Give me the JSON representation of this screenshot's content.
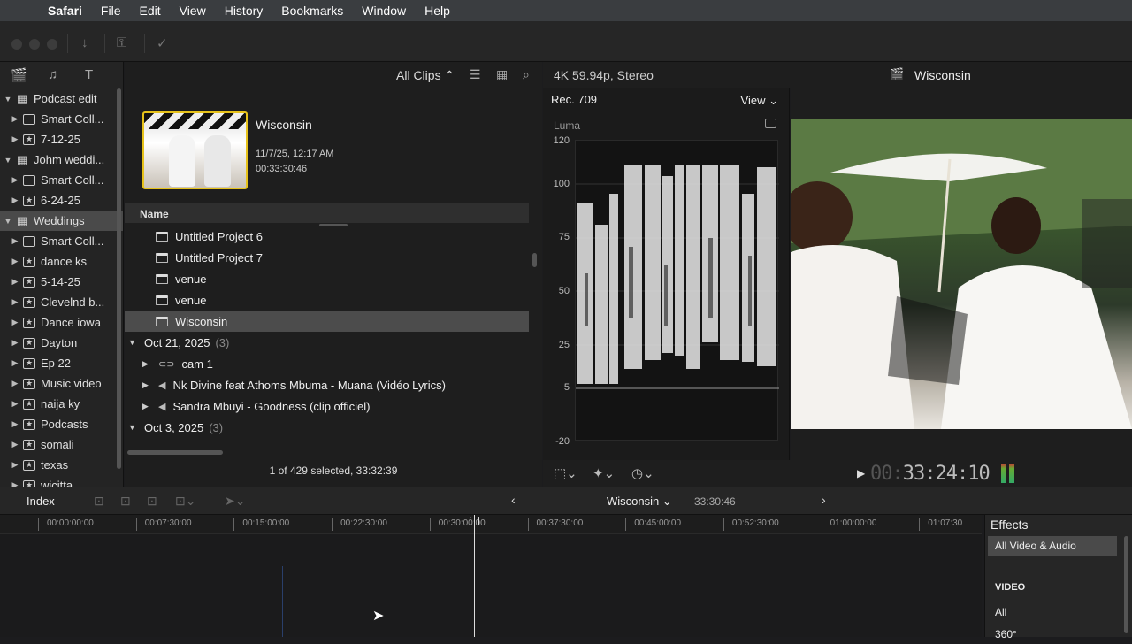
{
  "menubar": {
    "items": [
      "Safari",
      "File",
      "Edit",
      "View",
      "History",
      "Bookmarks",
      "Window",
      "Help"
    ]
  },
  "sidebar": {
    "items": [
      {
        "label": "Podcast edit",
        "type": "library",
        "open": true
      },
      {
        "label": "Smart Coll...",
        "type": "folder"
      },
      {
        "label": "7-12-25",
        "type": "event"
      },
      {
        "label": "Johm weddi...",
        "type": "library",
        "open": true
      },
      {
        "label": "Smart Coll...",
        "type": "folder"
      },
      {
        "label": "6-24-25",
        "type": "event"
      },
      {
        "label": "Weddings",
        "type": "library",
        "open": true,
        "selected": true
      },
      {
        "label": "Smart Coll...",
        "type": "folder"
      },
      {
        "label": "dance ks",
        "type": "event"
      },
      {
        "label": "5-14-25",
        "type": "event"
      },
      {
        "label": "Clevelnd b...",
        "type": "event"
      },
      {
        "label": "Dance  iowa",
        "type": "event"
      },
      {
        "label": "Dayton",
        "type": "event"
      },
      {
        "label": "Ep 22",
        "type": "event"
      },
      {
        "label": "Music video",
        "type": "event"
      },
      {
        "label": "naija ky",
        "type": "event"
      },
      {
        "label": "Podcasts",
        "type": "event"
      },
      {
        "label": "somali",
        "type": "event"
      },
      {
        "label": "texas",
        "type": "event"
      },
      {
        "label": "wicitta",
        "type": "event"
      }
    ]
  },
  "browser": {
    "filter": "All Clips",
    "clip": {
      "title": "Wisconsin",
      "date": "11/7/25, 12:17 AM",
      "duration": "00:33:30:46"
    },
    "column_header": "Name",
    "rows": [
      {
        "label": "Untitled Project 6",
        "kind": "project"
      },
      {
        "label": "Untitled Project 7",
        "kind": "project"
      },
      {
        "label": "venue",
        "kind": "project"
      },
      {
        "label": "venue",
        "kind": "project"
      },
      {
        "label": "Wisconsin",
        "kind": "project",
        "selected": true
      },
      {
        "label": "Oct 21, 2025",
        "kind": "group",
        "count": "(3)"
      },
      {
        "label": "cam 1",
        "kind": "clip-compound"
      },
      {
        "label": "Nk Divine feat Athoms Mbuma - Muana (Vidéo Lyrics)",
        "kind": "clip-audio"
      },
      {
        "label": "Sandra Mbuyi - Goodness (clip officiel)",
        "kind": "clip-audio"
      },
      {
        "label": "Oct 3, 2025",
        "kind": "group",
        "count": "(3)"
      }
    ],
    "status": "1 of 429 selected, 33:32:39"
  },
  "viewer": {
    "format": "4K 59.94p, Stereo",
    "title": "Wisconsin",
    "timecode_dim": "00:",
    "timecode": "33:24:10"
  },
  "scopes": {
    "colorspace": "Rec. 709",
    "view_label": "View",
    "type_label": "Luma",
    "y_ticks": [
      "120",
      "100",
      "75",
      "50",
      "25",
      "5",
      "-20"
    ]
  },
  "timeline": {
    "index_label": "Index",
    "project": "Wisconsin",
    "duration": "33:30:46",
    "ruler": [
      "00:00:00:00",
      "00:07:30:00",
      "00:15:00:00",
      "00:22:30:00",
      "00:30:00:00",
      "00:37:30:00",
      "00:45:00:00",
      "00:52:30:00",
      "01:00:00:00",
      "01:07:30"
    ]
  },
  "effects": {
    "title": "Effects",
    "selected": "All Video & Audio",
    "section": "VIDEO",
    "items": [
      "All",
      "360°"
    ]
  }
}
